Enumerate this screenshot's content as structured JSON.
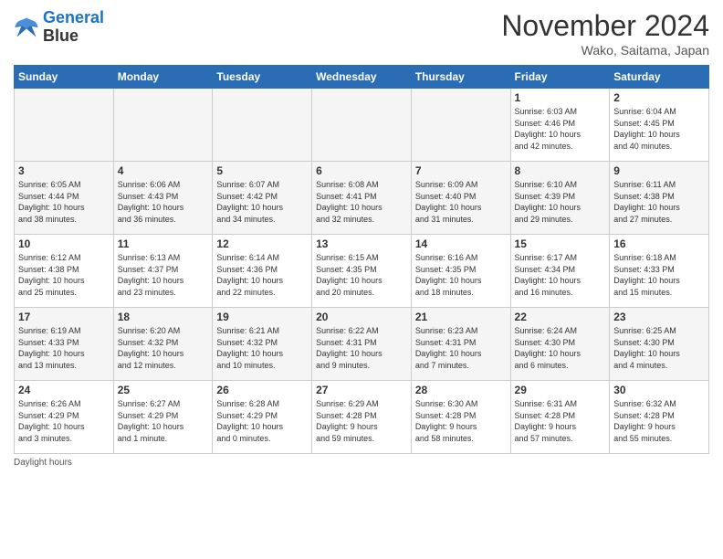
{
  "header": {
    "logo_line1": "General",
    "logo_line2": "Blue",
    "month_title": "November 2024",
    "location": "Wako, Saitama, Japan"
  },
  "days_of_week": [
    "Sunday",
    "Monday",
    "Tuesday",
    "Wednesday",
    "Thursday",
    "Friday",
    "Saturday"
  ],
  "weeks": [
    [
      {
        "day": "",
        "info": "",
        "empty": true
      },
      {
        "day": "",
        "info": "",
        "empty": true
      },
      {
        "day": "",
        "info": "",
        "empty": true
      },
      {
        "day": "",
        "info": "",
        "empty": true
      },
      {
        "day": "",
        "info": "",
        "empty": true
      },
      {
        "day": "1",
        "info": "Sunrise: 6:03 AM\nSunset: 4:46 PM\nDaylight: 10 hours\nand 42 minutes."
      },
      {
        "day": "2",
        "info": "Sunrise: 6:04 AM\nSunset: 4:45 PM\nDaylight: 10 hours\nand 40 minutes."
      }
    ],
    [
      {
        "day": "3",
        "info": "Sunrise: 6:05 AM\nSunset: 4:44 PM\nDaylight: 10 hours\nand 38 minutes."
      },
      {
        "day": "4",
        "info": "Sunrise: 6:06 AM\nSunset: 4:43 PM\nDaylight: 10 hours\nand 36 minutes."
      },
      {
        "day": "5",
        "info": "Sunrise: 6:07 AM\nSunset: 4:42 PM\nDaylight: 10 hours\nand 34 minutes."
      },
      {
        "day": "6",
        "info": "Sunrise: 6:08 AM\nSunset: 4:41 PM\nDaylight: 10 hours\nand 32 minutes."
      },
      {
        "day": "7",
        "info": "Sunrise: 6:09 AM\nSunset: 4:40 PM\nDaylight: 10 hours\nand 31 minutes."
      },
      {
        "day": "8",
        "info": "Sunrise: 6:10 AM\nSunset: 4:39 PM\nDaylight: 10 hours\nand 29 minutes."
      },
      {
        "day": "9",
        "info": "Sunrise: 6:11 AM\nSunset: 4:38 PM\nDaylight: 10 hours\nand 27 minutes."
      }
    ],
    [
      {
        "day": "10",
        "info": "Sunrise: 6:12 AM\nSunset: 4:38 PM\nDaylight: 10 hours\nand 25 minutes."
      },
      {
        "day": "11",
        "info": "Sunrise: 6:13 AM\nSunset: 4:37 PM\nDaylight: 10 hours\nand 23 minutes."
      },
      {
        "day": "12",
        "info": "Sunrise: 6:14 AM\nSunset: 4:36 PM\nDaylight: 10 hours\nand 22 minutes."
      },
      {
        "day": "13",
        "info": "Sunrise: 6:15 AM\nSunset: 4:35 PM\nDaylight: 10 hours\nand 20 minutes."
      },
      {
        "day": "14",
        "info": "Sunrise: 6:16 AM\nSunset: 4:35 PM\nDaylight: 10 hours\nand 18 minutes."
      },
      {
        "day": "15",
        "info": "Sunrise: 6:17 AM\nSunset: 4:34 PM\nDaylight: 10 hours\nand 16 minutes."
      },
      {
        "day": "16",
        "info": "Sunrise: 6:18 AM\nSunset: 4:33 PM\nDaylight: 10 hours\nand 15 minutes."
      }
    ],
    [
      {
        "day": "17",
        "info": "Sunrise: 6:19 AM\nSunset: 4:33 PM\nDaylight: 10 hours\nand 13 minutes."
      },
      {
        "day": "18",
        "info": "Sunrise: 6:20 AM\nSunset: 4:32 PM\nDaylight: 10 hours\nand 12 minutes."
      },
      {
        "day": "19",
        "info": "Sunrise: 6:21 AM\nSunset: 4:32 PM\nDaylight: 10 hours\nand 10 minutes."
      },
      {
        "day": "20",
        "info": "Sunrise: 6:22 AM\nSunset: 4:31 PM\nDaylight: 10 hours\nand 9 minutes."
      },
      {
        "day": "21",
        "info": "Sunrise: 6:23 AM\nSunset: 4:31 PM\nDaylight: 10 hours\nand 7 minutes."
      },
      {
        "day": "22",
        "info": "Sunrise: 6:24 AM\nSunset: 4:30 PM\nDaylight: 10 hours\nand 6 minutes."
      },
      {
        "day": "23",
        "info": "Sunrise: 6:25 AM\nSunset: 4:30 PM\nDaylight: 10 hours\nand 4 minutes."
      }
    ],
    [
      {
        "day": "24",
        "info": "Sunrise: 6:26 AM\nSunset: 4:29 PM\nDaylight: 10 hours\nand 3 minutes."
      },
      {
        "day": "25",
        "info": "Sunrise: 6:27 AM\nSunset: 4:29 PM\nDaylight: 10 hours\nand 1 minute."
      },
      {
        "day": "26",
        "info": "Sunrise: 6:28 AM\nSunset: 4:29 PM\nDaylight: 10 hours\nand 0 minutes."
      },
      {
        "day": "27",
        "info": "Sunrise: 6:29 AM\nSunset: 4:28 PM\nDaylight: 9 hours\nand 59 minutes."
      },
      {
        "day": "28",
        "info": "Sunrise: 6:30 AM\nSunset: 4:28 PM\nDaylight: 9 hours\nand 58 minutes."
      },
      {
        "day": "29",
        "info": "Sunrise: 6:31 AM\nSunset: 4:28 PM\nDaylight: 9 hours\nand 57 minutes."
      },
      {
        "day": "30",
        "info": "Sunrise: 6:32 AM\nSunset: 4:28 PM\nDaylight: 9 hours\nand 55 minutes."
      }
    ]
  ],
  "footer": "Daylight hours"
}
